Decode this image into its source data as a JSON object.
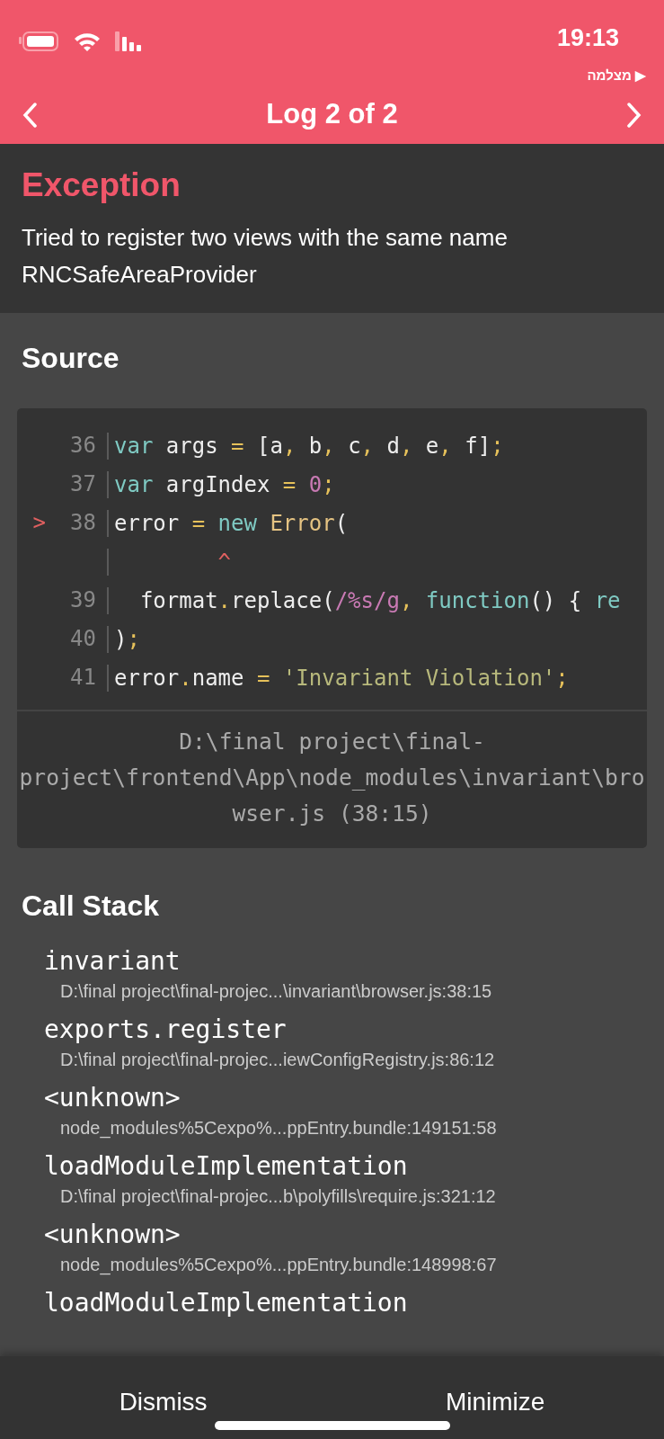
{
  "status_bar": {
    "time": "19:13",
    "back_app": "מצלמה",
    "back_arrow": "▶"
  },
  "nav": {
    "title": "Log 2 of 2"
  },
  "exception": {
    "title": "Exception",
    "message": "Tried to register two views with the same name RNCSafeAreaProvider"
  },
  "source": {
    "title": "Source",
    "marker": ">",
    "lines": [
      {
        "kind": "code",
        "number": "36",
        "selected": false,
        "tokens": [
          {
            "kind": "keyword",
            "text": "var"
          },
          {
            "kind": "plain",
            "text": " args "
          },
          {
            "kind": "punct",
            "text": "="
          },
          {
            "kind": "plain",
            "text": " [a"
          },
          {
            "kind": "punct",
            "text": ","
          },
          {
            "kind": "plain",
            "text": " b"
          },
          {
            "kind": "punct",
            "text": ","
          },
          {
            "kind": "plain",
            "text": " c"
          },
          {
            "kind": "punct",
            "text": ","
          },
          {
            "kind": "plain",
            "text": " d"
          },
          {
            "kind": "punct",
            "text": ","
          },
          {
            "kind": "plain",
            "text": " e"
          },
          {
            "kind": "punct",
            "text": ","
          },
          {
            "kind": "plain",
            "text": " f]"
          },
          {
            "kind": "punct",
            "text": ";"
          }
        ]
      },
      {
        "kind": "code",
        "number": "37",
        "selected": false,
        "tokens": [
          {
            "kind": "keyword",
            "text": "var"
          },
          {
            "kind": "plain",
            "text": " argIndex "
          },
          {
            "kind": "punct",
            "text": "= "
          },
          {
            "kind": "number",
            "text": "0"
          },
          {
            "kind": "punct",
            "text": ";"
          }
        ]
      },
      {
        "kind": "code",
        "number": "38",
        "selected": true,
        "tokens": [
          {
            "kind": "plain",
            "text": "error "
          },
          {
            "kind": "punct",
            "text": "= "
          },
          {
            "kind": "keyword",
            "text": "new "
          },
          {
            "kind": "func",
            "text": "Error"
          },
          {
            "kind": "plain",
            "text": "("
          }
        ]
      },
      {
        "kind": "caret",
        "tokens": [
          {
            "kind": "caret",
            "text": "        ^"
          }
        ]
      },
      {
        "kind": "code",
        "number": "39",
        "selected": false,
        "tokens": [
          {
            "kind": "plain",
            "text": "  format"
          },
          {
            "kind": "punct",
            "text": "."
          },
          {
            "kind": "plain",
            "text": "replace("
          },
          {
            "kind": "number",
            "text": "/%s/g"
          },
          {
            "kind": "punct",
            "text": ", "
          },
          {
            "kind": "keyword",
            "text": "function"
          },
          {
            "kind": "plain",
            "text": "() { "
          },
          {
            "kind": "keyword",
            "text": "re"
          }
        ]
      },
      {
        "kind": "code",
        "number": "40",
        "selected": false,
        "tokens": [
          {
            "kind": "plain",
            "text": ")"
          },
          {
            "kind": "punct",
            "text": ";"
          }
        ]
      },
      {
        "kind": "code",
        "number": "41",
        "selected": false,
        "tokens": [
          {
            "kind": "plain",
            "text": "error"
          },
          {
            "kind": "punct",
            "text": "."
          },
          {
            "kind": "plain",
            "text": "name "
          },
          {
            "kind": "punct",
            "text": "= "
          },
          {
            "kind": "string",
            "text": "'Invariant Violation'"
          },
          {
            "kind": "punct",
            "text": ";"
          }
        ]
      }
    ],
    "file": "D:\\final project\\final-project\\frontend\\App\\node_modules\\invariant\\browser.js (38:15)"
  },
  "call_stack": {
    "title": "Call Stack",
    "frames": [
      {
        "method": "invariant",
        "location": "D:\\final project\\final-projec...\\invariant\\browser.js:38:15"
      },
      {
        "method": "exports.register",
        "location": "D:\\final project\\final-projec...iewConfigRegistry.js:86:12"
      },
      {
        "method": "<unknown>",
        "location": "node_modules%5Cexpo%...ppEntry.bundle:149151:58"
      },
      {
        "method": "loadModuleImplementation",
        "location": "D:\\final project\\final-projec...b\\polyfills\\require.js:321:12"
      },
      {
        "method": "<unknown>",
        "location": "node_modules%5Cexpo%...ppEntry.bundle:148998:67"
      },
      {
        "method": "loadModuleImplementation"
      }
    ]
  },
  "footer": {
    "buttons": [
      "Dismiss",
      "Minimize"
    ]
  }
}
